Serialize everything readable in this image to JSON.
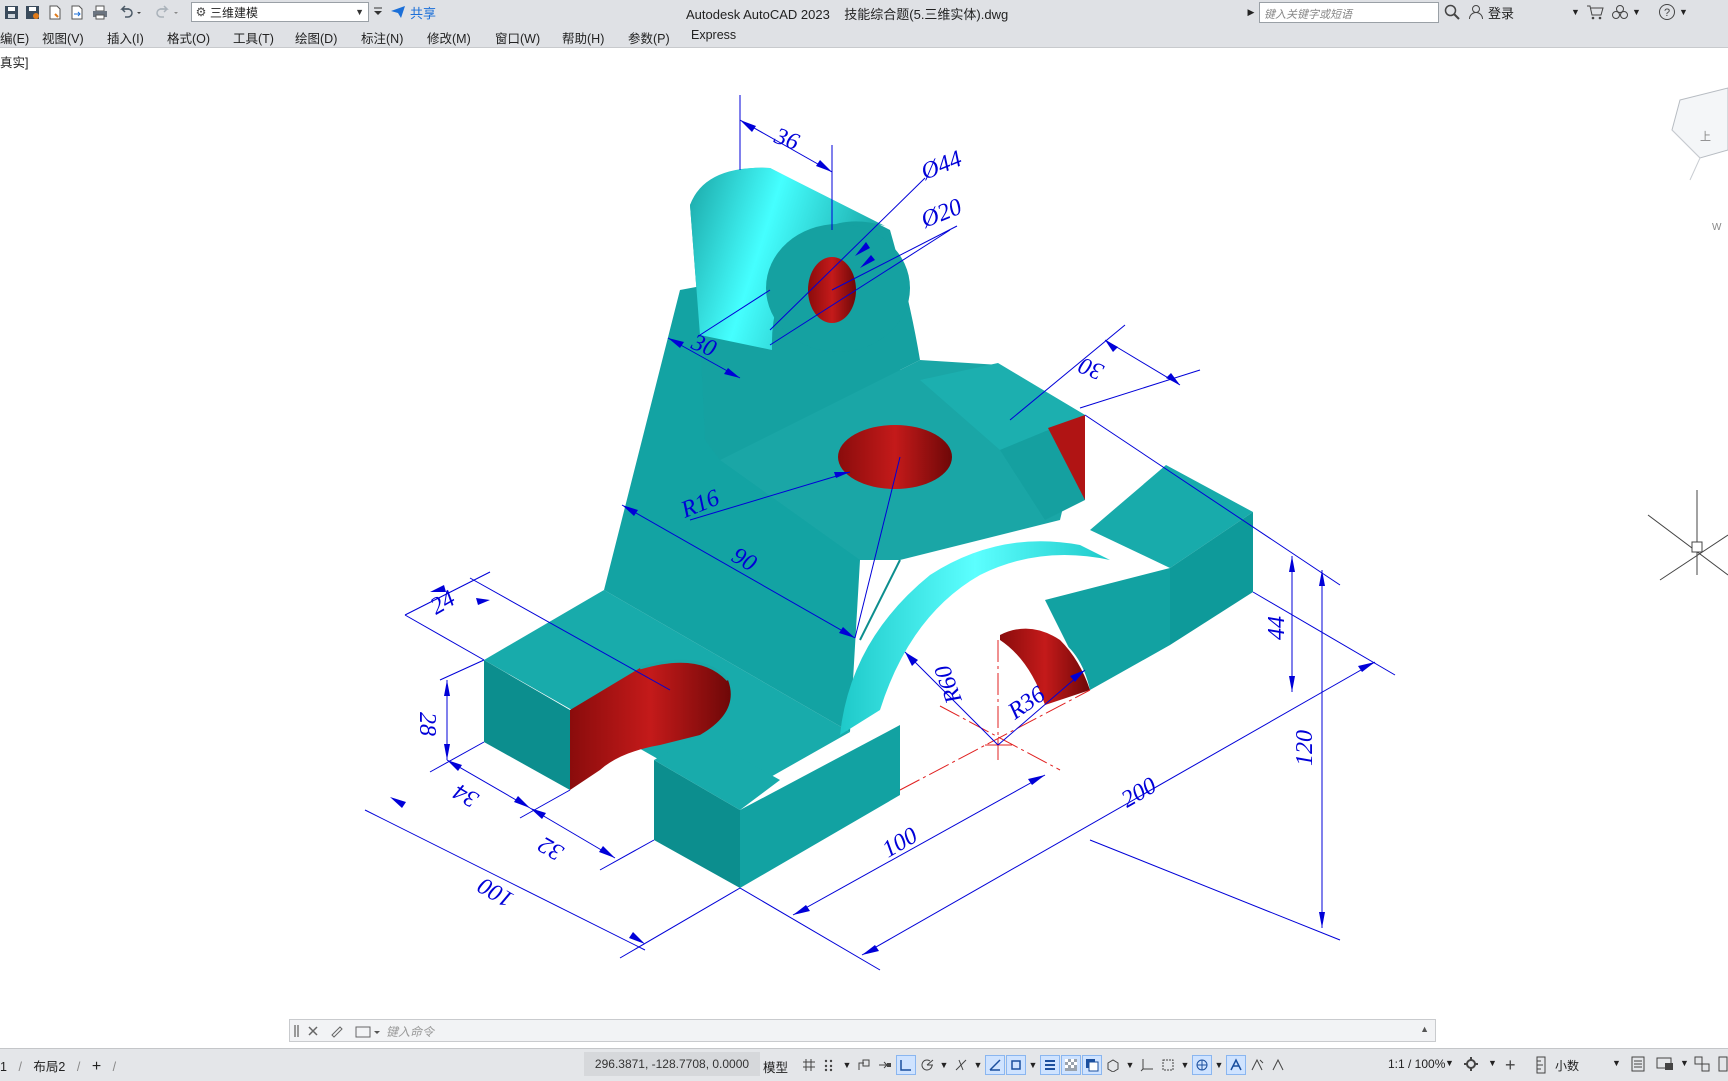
{
  "titlebar": {
    "workspace": "三维建模",
    "share_label": "共享",
    "app_title": "Autodesk AutoCAD 2023    技能综合题(5.三维实体).dwg",
    "search_placeholder": "键入关键字或短语",
    "login_label": "登录"
  },
  "menu": [
    "编(E)",
    "视图(V)",
    "插入(I)",
    "格式(O)",
    "工具(T)",
    "绘图(D)",
    "标注(N)",
    "修改(M)",
    "窗口(W)",
    "帮助(H)",
    "参数(P)",
    "Express"
  ],
  "viewport": {
    "label": "真实]",
    "dimensions": {
      "d36": "36",
      "dia44": "Ø44",
      "dia20": "Ø20",
      "d30a": "30",
      "d30b": "30",
      "r16": "R16",
      "d90": "90",
      "d24": "24",
      "d28": "28",
      "d34": "34",
      "d32": "32",
      "d100a": "100",
      "d100b": "100",
      "d200": "200",
      "d120": "120",
      "d44": "44",
      "r60": "R60",
      "r36": "R36"
    }
  },
  "command": {
    "placeholder": "键入命令"
  },
  "status": {
    "tab_model_tail": "1",
    "tab_layout2": "布局2",
    "add_tab": "+",
    "coordinates": "296.3871, -128.7708, 0.0000",
    "model": "模型",
    "scale": "1:1 / 100%",
    "units": "小数"
  },
  "colors": {
    "solid_face_light": "#1fb3b3",
    "solid_face_dark": "#0a8e8e",
    "solid_face_highlight": "#3df5f5",
    "hole_red": "#b01414",
    "dimension_blue": "#0000d8",
    "centerline_red": "#e02020"
  }
}
